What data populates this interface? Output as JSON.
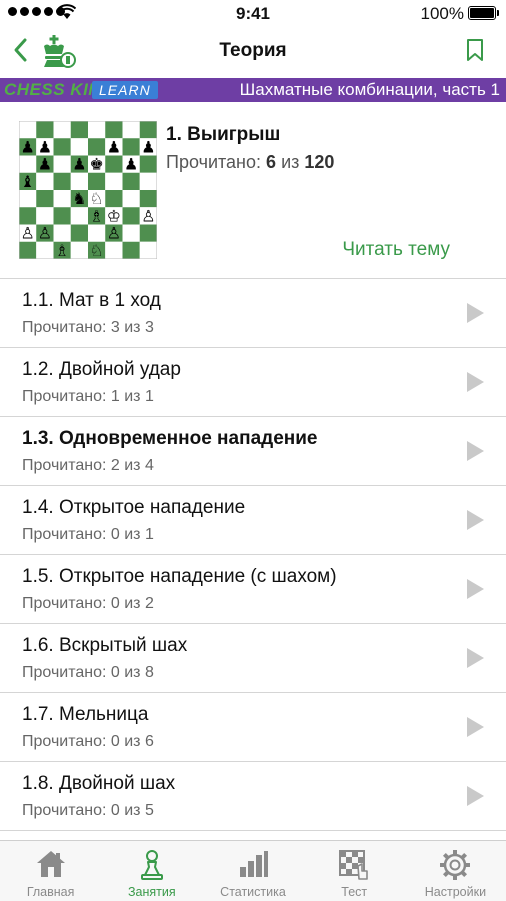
{
  "status_bar": {
    "time": "9:41",
    "battery": "100%"
  },
  "nav": {
    "title": "Теория",
    "back_icon": "chevron-left-icon",
    "logo_icon": "chess-king-logo-icon",
    "bookmark_icon": "bookmark-icon"
  },
  "banner": {
    "brand": "CHESS KING",
    "learn": "LEARN",
    "course": "Шахматные комбинации, часть 1"
  },
  "topic": {
    "title": "1. Выигрыш",
    "progress_prefix": "Прочитано:",
    "progress_read": "6",
    "progress_of": "из",
    "progress_total": "120",
    "read_link": "Читать тему"
  },
  "lessons": [
    {
      "title": "1.1. Мат в 1 ход",
      "status": "Прочитано: 3 из 3",
      "bold": false
    },
    {
      "title": "1.2. Двойной удар",
      "status": "Прочитано: 1 из 1",
      "bold": false
    },
    {
      "title": "1.3. Одновременное нападение",
      "status": "Прочитано: 2 из 4",
      "bold": true
    },
    {
      "title": "1.4. Открытое нападение",
      "status": "Прочитано: 0 из 1",
      "bold": false
    },
    {
      "title": "1.5. Открытое нападение (с шахом)",
      "status": "Прочитано: 0 из 2",
      "bold": false
    },
    {
      "title": "1.6. Вскрытый шах",
      "status": "Прочитано: 0 из 8",
      "bold": false
    },
    {
      "title": "1.7. Мельница",
      "status": "Прочитано: 0 из 6",
      "bold": false
    },
    {
      "title": "1.8. Двойной шах",
      "status": "Прочитано: 0 из 5",
      "bold": false
    }
  ],
  "tabs": [
    {
      "label": "Главная",
      "icon": "home-icon",
      "active": false
    },
    {
      "label": "Занятия",
      "icon": "pawn-icon",
      "active": true
    },
    {
      "label": "Статистика",
      "icon": "bar-chart-icon",
      "active": false
    },
    {
      "label": "Тест",
      "icon": "test-board-icon",
      "active": false
    },
    {
      "label": "Настройки",
      "icon": "gear-icon",
      "active": false
    }
  ],
  "colors": {
    "accent": "#3a9a4a",
    "banner": "#6e3ea4",
    "learn_badge": "#3a7fd6",
    "board_dark": "#4f8f4f",
    "board_light": "#ffffff"
  },
  "board_position": [
    "........",
    "pp...p.p",
    ".p.pk.p.",
    "b.......",
    "...nN...",
    "....BK.P",
    "PP...P..",
    "..B.N..."
  ]
}
